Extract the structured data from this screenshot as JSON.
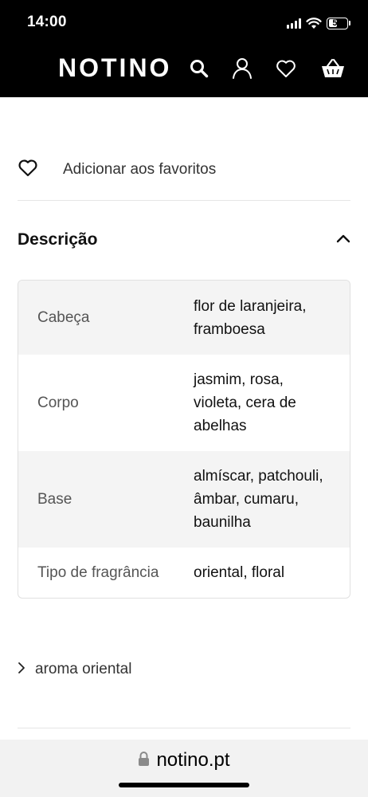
{
  "status_bar": {
    "time": "14:00",
    "battery": "50",
    "battery_level": 0.5
  },
  "header": {
    "logo": "NOTINO",
    "icons": [
      "search-icon",
      "user-icon",
      "heart-icon",
      "basket-icon"
    ]
  },
  "favorites": {
    "label": "Adicionar aos favoritos"
  },
  "description": {
    "title": "Descrição",
    "expanded": true,
    "notes": [
      {
        "key": "Cabeça",
        "value": "flor de laranjeira,\nframboesa"
      },
      {
        "key": "Corpo",
        "value": "jasmim, rosa,\nvioleta, cera de\nabelhas"
      },
      {
        "key": "Base",
        "value": "almíscar, patchouli,\nâmbar, cumaru,\nbaunilha"
      },
      {
        "key": "Tipo de fragrância",
        "value": "oriental, floral"
      }
    ]
  },
  "aroma_link": {
    "label": "aroma oriental"
  },
  "browser": {
    "url": "notino.pt"
  },
  "colors": {
    "header_bg": "#000000",
    "row_shade": "#f4f4f4",
    "url_bar_bg": "#f2f2f2"
  }
}
